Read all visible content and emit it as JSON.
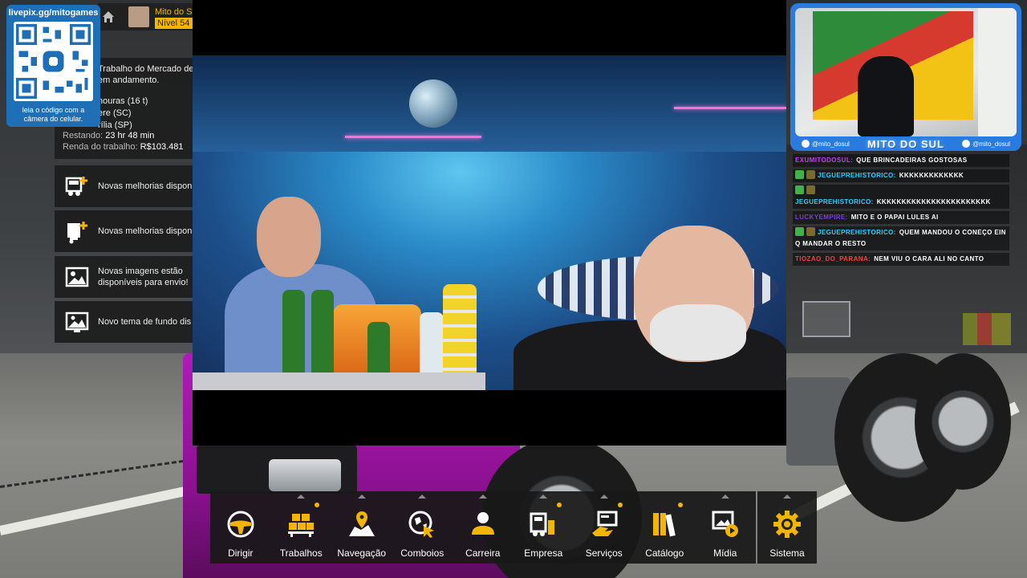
{
  "qr": {
    "title": "livepix.gg/mitogames",
    "caption_line1": "leia o código com a",
    "caption_line2": "câmera do celular."
  },
  "player": {
    "name": "Mito do S",
    "level": "Nível 54"
  },
  "job": {
    "line1": "Trabalho do Mercado de",
    "line2": "em andamento.",
    "cargo": "nouras (16 t)",
    "origin": "ere (SC)",
    "destination": "rília (SP)",
    "remaining_label": "Restando:",
    "remaining_value": "23 hr 48 min",
    "income_label": "Renda do trabalho:",
    "income_value": "R$103.481"
  },
  "notifications": [
    {
      "icon": "truck-upgrade-icon",
      "text": "Novas melhorias dispon"
    },
    {
      "icon": "trailer-upgrade-icon",
      "text": "Novas melhorias dispon"
    },
    {
      "icon": "image-icon",
      "text_line1": "Novas imagens estão",
      "text_line2": "disponíveis para envio!"
    },
    {
      "icon": "wallpaper-icon",
      "text": "Novo tema de fundo dis"
    }
  ],
  "webcam": {
    "tiktok_handle": "@mito_dosul",
    "title": "MITO DO SUL",
    "instagram_handle": "@mito_dosul"
  },
  "chat": [
    {
      "user": "EXUMITODOSUL:",
      "text": "QUE BRINCADEIRAS GOSTOSAS",
      "user_color": "#c23ff2",
      "badges": []
    },
    {
      "user": "JEGUEPREHISTORICO:",
      "text": "KKKKKKKKKKKKK",
      "user_color": "#2ad1ff",
      "badges": [
        "#3fb34a",
        "#7a6b2a"
      ]
    },
    {
      "user": "JEGUEPREHISTORICO:",
      "text": "KKKKKKKKKKKKKKKKKKKKKKK",
      "user_color": "#2ad1ff",
      "badges": [
        "#3fb34a",
        "#7a6b2a"
      ]
    },
    {
      "user": "LUCKYEMPIRE:",
      "text": "MITO E O PAPAI LULES AI",
      "user_color": "#7b3fd6",
      "badges": []
    },
    {
      "user": "JEGUEPREHISTORICO:",
      "text": "QUEM MANDOU O CONEÇO EIN Q MANDAR O RESTO",
      "user_color": "#2ad1ff",
      "badges": [
        "#3fb34a",
        "#7a6b2a"
      ]
    },
    {
      "user": "TIOZAO_DO_PARANA:",
      "text": "NEM VIU O CARA ALI NO CANTO",
      "user_color": "#ff3b3b",
      "badges": []
    }
  ],
  "menu": [
    {
      "label": "Dirigir",
      "icon": "steering-wheel-icon",
      "dot": false,
      "caret": false
    },
    {
      "label": "Trabalhos",
      "icon": "cargo-boxes-icon",
      "dot": true,
      "caret": true
    },
    {
      "label": "Navegação",
      "icon": "map-pin-icon",
      "dot": false,
      "caret": true
    },
    {
      "label": "Comboios",
      "icon": "globe-cursor-icon",
      "dot": false,
      "caret": true
    },
    {
      "label": "Carreira",
      "icon": "person-icon",
      "dot": false,
      "caret": true
    },
    {
      "label": "Empresa",
      "icon": "company-icon",
      "dot": true,
      "caret": true
    },
    {
      "label": "Serviços",
      "icon": "services-icon",
      "dot": true,
      "caret": true
    },
    {
      "label": "Catálogo",
      "icon": "books-icon",
      "dot": true,
      "caret": false
    },
    {
      "label": "Mídia",
      "icon": "media-icon",
      "dot": false,
      "caret": true
    },
    {
      "label": "Sistema",
      "icon": "gear-icon",
      "dot": false,
      "caret": true
    }
  ],
  "colors": {
    "accent": "#f2b600",
    "qr_panel": "#1e6fb6",
    "cam_border": "#2a7be0"
  }
}
